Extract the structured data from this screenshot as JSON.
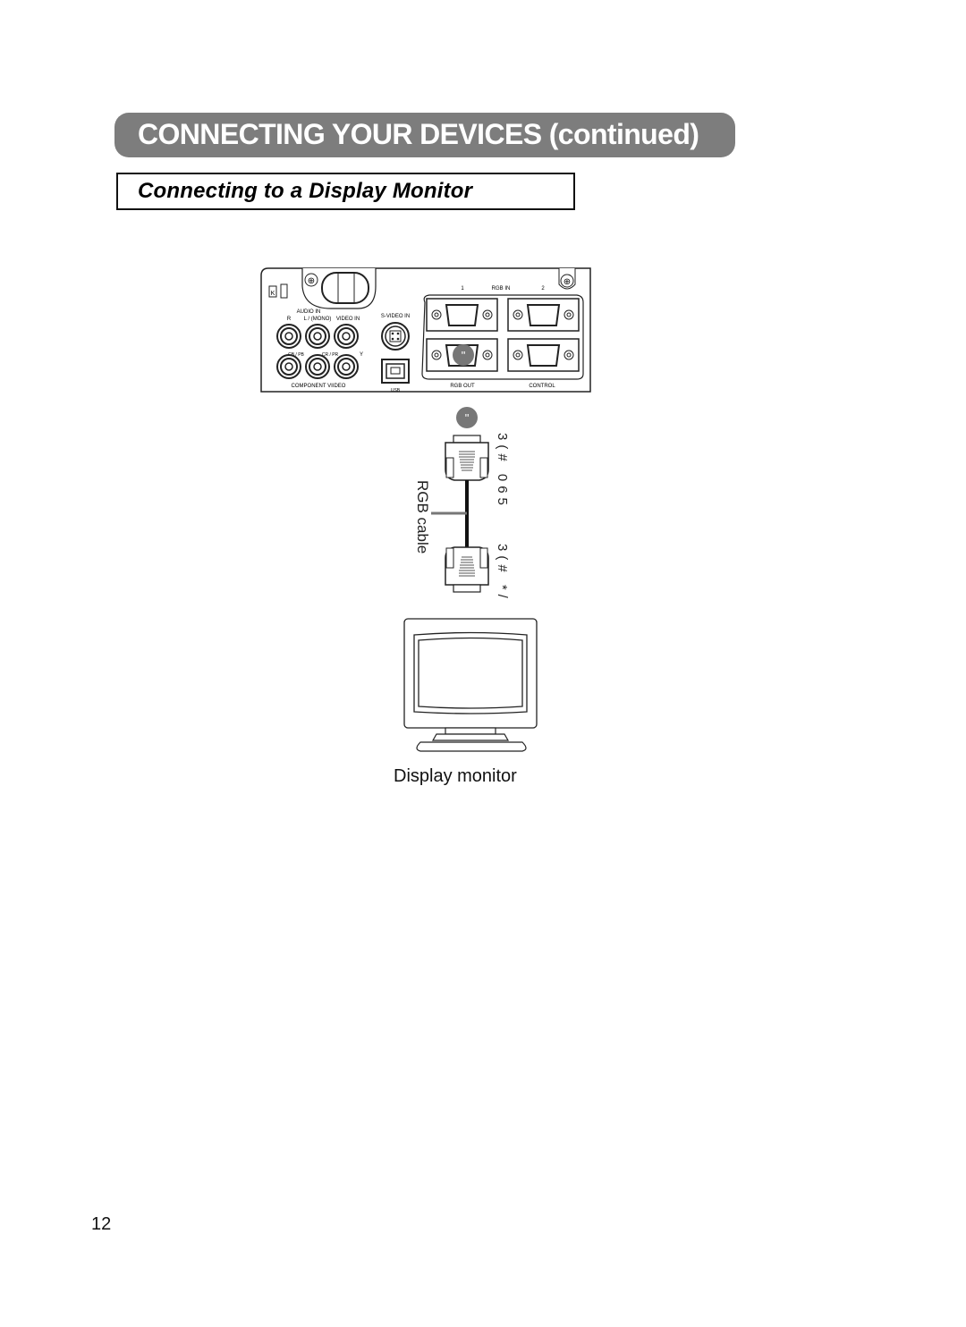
{
  "page": {
    "section_title": "CONNECTING YOUR DEVICES (continued)",
    "subsection_title": "Connecting to a Display Monitor",
    "page_number": "12"
  },
  "colors": {
    "banner_bg": "#7d7d7d",
    "banner_text": "#ffffff",
    "marker": "#777777"
  },
  "panel": {
    "audio_in": "AUDIO IN",
    "r": "R",
    "l_mono": "L / (MONO)",
    "video_in": "VIDEO IN",
    "s_video_in": "S-VIDEO IN",
    "cb_pb": "CB / PB",
    "cr_pr": "CR / PR",
    "y": "Y",
    "component_video": "COMPONENT  VIIDEO",
    "usb": "USB",
    "rgb_in_1": "1",
    "rgb_in": "RGB   IN",
    "rgb_in_2": "2",
    "rgb_out": "RGB   OUT",
    "control": "CONTROL",
    "kensington": "K"
  },
  "markers": {
    "panel_marker": "\"",
    "cable_marker": "\""
  },
  "cable": {
    "label": "RGB cable",
    "top_code": "3(# 065",
    "bottom_code": "3(# */"
  },
  "monitor": {
    "caption": "Display monitor"
  }
}
